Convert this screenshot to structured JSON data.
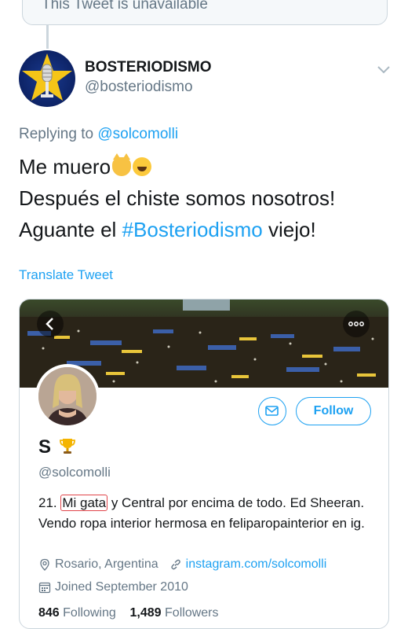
{
  "quoted": {
    "text": "This Tweet is unavailable"
  },
  "author": {
    "name": "BOSTERIODISMO",
    "handle": "@bosteriodismo"
  },
  "reply": {
    "prefix": "Replying to ",
    "target": "@solcomolli"
  },
  "tweet": {
    "line1": "Me muero",
    "line2": "Después el chiste somos nosotros!",
    "line3_prefix": "Aguante el ",
    "line3_hashtag": "#Bosteriodismo",
    "line3_suffix": " viejo!",
    "emojis": [
      "cat-face-emoji",
      "laughing-tears-emoji"
    ]
  },
  "translate_label": "Translate Tweet",
  "profile_card": {
    "name": "S",
    "name_icon": "trophy-icon",
    "handle": "@solcomolli",
    "bio_prefix": "21. ",
    "bio_circled": "Mi gata",
    "bio_rest": " y Central por encima de todo. Ed Sheeran. Vendo ropa interior hermosa en feliparopainterior en ig.",
    "location": "Rosario, Argentina",
    "website": "instagram.com/solcomolli",
    "joined": "Joined September 2010",
    "following_count": "846",
    "following_label": "Following",
    "followers_count": "1,489",
    "followers_label": "Followers",
    "follow_button": "Follow"
  },
  "colors": {
    "accent": "#1da1f2",
    "secondary_text": "#657786",
    "annotation_red": "#e0454a"
  }
}
